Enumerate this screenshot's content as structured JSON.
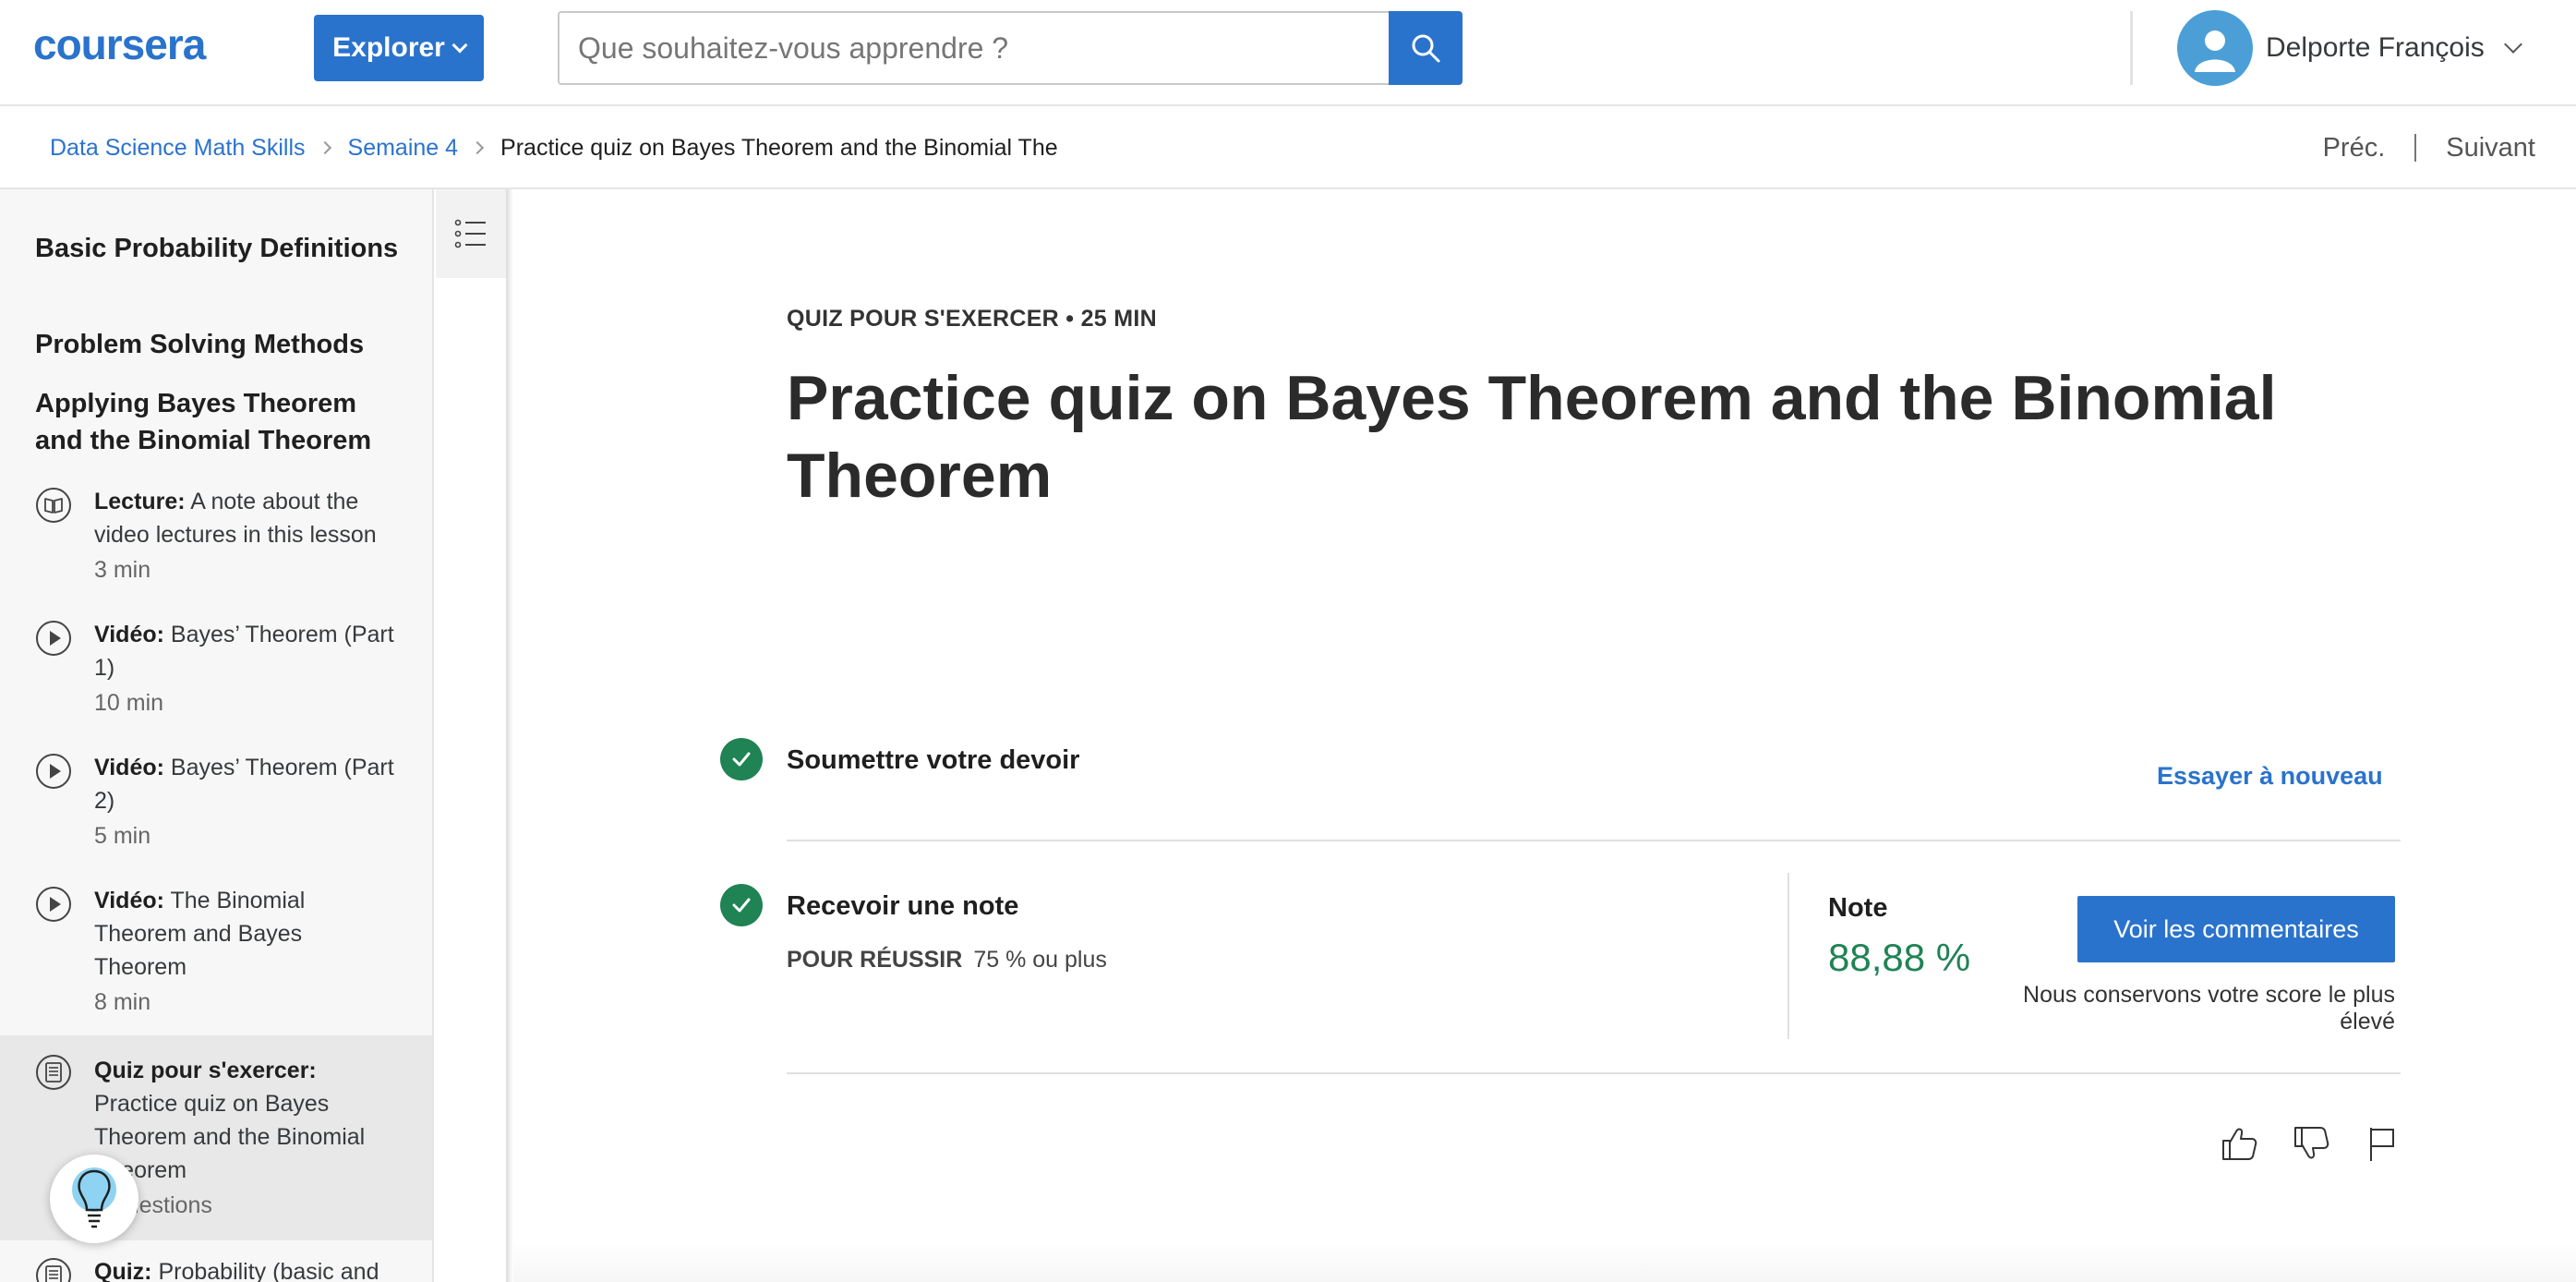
{
  "header": {
    "logo_text": "coursera",
    "explore_label": "Explorer",
    "search_placeholder": "Que souhaitez-vous apprendre ?",
    "user_name": "Delporte François"
  },
  "breadcrumb": {
    "course": "Data Science Math Skills",
    "week": "Semaine 4",
    "current": "Practice quiz on Bayes Theorem and the Binomial The",
    "prev_label": "Préc.",
    "next_label": "Suivant"
  },
  "sidebar": {
    "sections": [
      "Basic Probability Definitions",
      "Problem Solving Methods",
      "Applying Bayes Theorem and the Binomial Theorem"
    ],
    "items": [
      {
        "type": "Lecture:",
        "title": "A note about the video lectures in this lesson",
        "duration": "3  min",
        "icon": "book-icon"
      },
      {
        "type": "Vidéo:",
        "title": "Bayes’ Theorem (Part 1)",
        "duration": "10  min",
        "icon": "play-icon"
      },
      {
        "type": "Vidéo:",
        "title": "Bayes’ Theorem (Part 2)",
        "duration": "5  min",
        "icon": "play-icon"
      },
      {
        "type": "Vidéo:",
        "title": "The Binomial Theorem and Bayes Theorem",
        "duration": "8  min",
        "icon": "play-icon"
      },
      {
        "type": "Quiz pour s'exercer:",
        "title": "Practice quiz on Bayes Theorem and the Binomial Theorem",
        "duration": "9 questions",
        "icon": "quiz-icon"
      },
      {
        "type": "Quiz:",
        "title": "Probability (basic and",
        "duration": "",
        "icon": "quiz-icon"
      }
    ]
  },
  "main": {
    "kicker": "QUIZ POUR S'EXERCER • 25  MIN",
    "title": "Practice quiz on Bayes Theorem and the Binomial Theorem",
    "step1_label": "Soumettre votre devoir",
    "retry_label": "Essayer à nouveau",
    "step2_label": "Recevoir une note",
    "pass_caption": "POUR RÉUSSIR",
    "pass_value": "75 % ou plus",
    "grade_label": "Note",
    "grade_value": "88,88 %",
    "comments_button": "Voir les commentaires",
    "keep_score_text": "Nous conservons votre score le plus élevé"
  },
  "colors": {
    "brand_blue": "#2a73cc",
    "success_green": "#1f8354"
  }
}
